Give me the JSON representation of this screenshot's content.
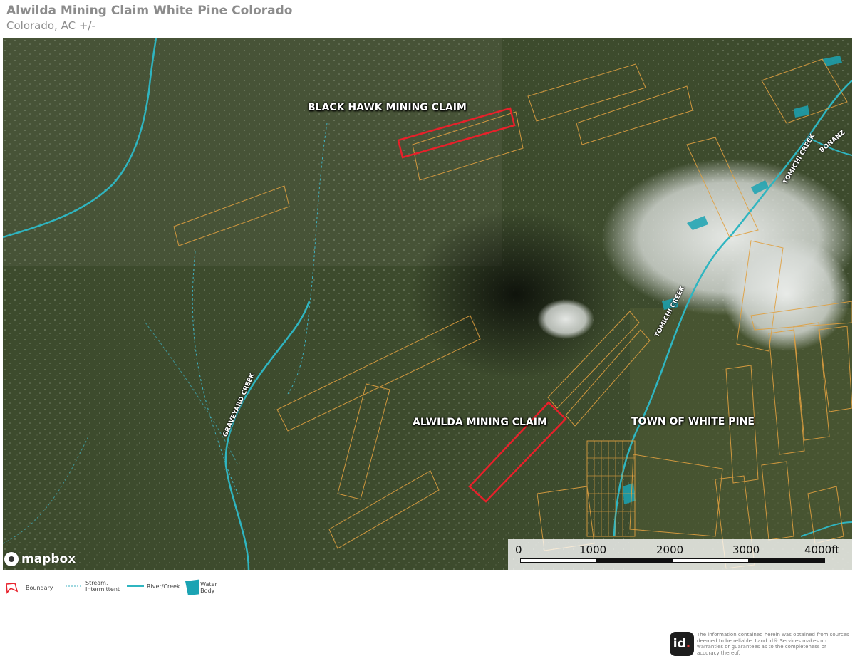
{
  "header": {
    "title": "Alwilda Mining Claim White Pine Colorado",
    "subtitle": "Colorado,  AC +/-"
  },
  "map": {
    "labels": {
      "black_hawk": "BLACK HAWK MINING CLAIM",
      "alwilda": "ALWILDA MINING CLAIM",
      "town": "TOWN OF WHITE PINE"
    },
    "creeks": {
      "graveyard": "GRAVEYARD CREEK",
      "tomichi_upper": "TOMICHI CREEK",
      "tomichi_lower": "TOMICHI CREEK",
      "bonanza": "BONANZ"
    },
    "attribution": "mapbox",
    "colors": {
      "boundary": "#e8202a",
      "parcel": "#e0a040",
      "river": "#2fb5c0",
      "stream": "#3fb0c0",
      "water_body": "#1ba3b3"
    }
  },
  "scale_bar": {
    "ticks": [
      "0",
      "1000",
      "2000",
      "3000",
      "4000ft"
    ]
  },
  "legend": {
    "boundary": "Boundary",
    "stream": "Stream, Intermittent",
    "stream_line1": "Stream,",
    "stream_line2": "Intermittent",
    "river": "River/Creek",
    "water_body": "Water Body"
  },
  "footer": {
    "logo_text": "id",
    "disclaimer": "The information contained herein was obtained from sources deemed to be reliable. Land id® Services makes no warranties or guarantees as to the completeness or accuracy thereof."
  }
}
